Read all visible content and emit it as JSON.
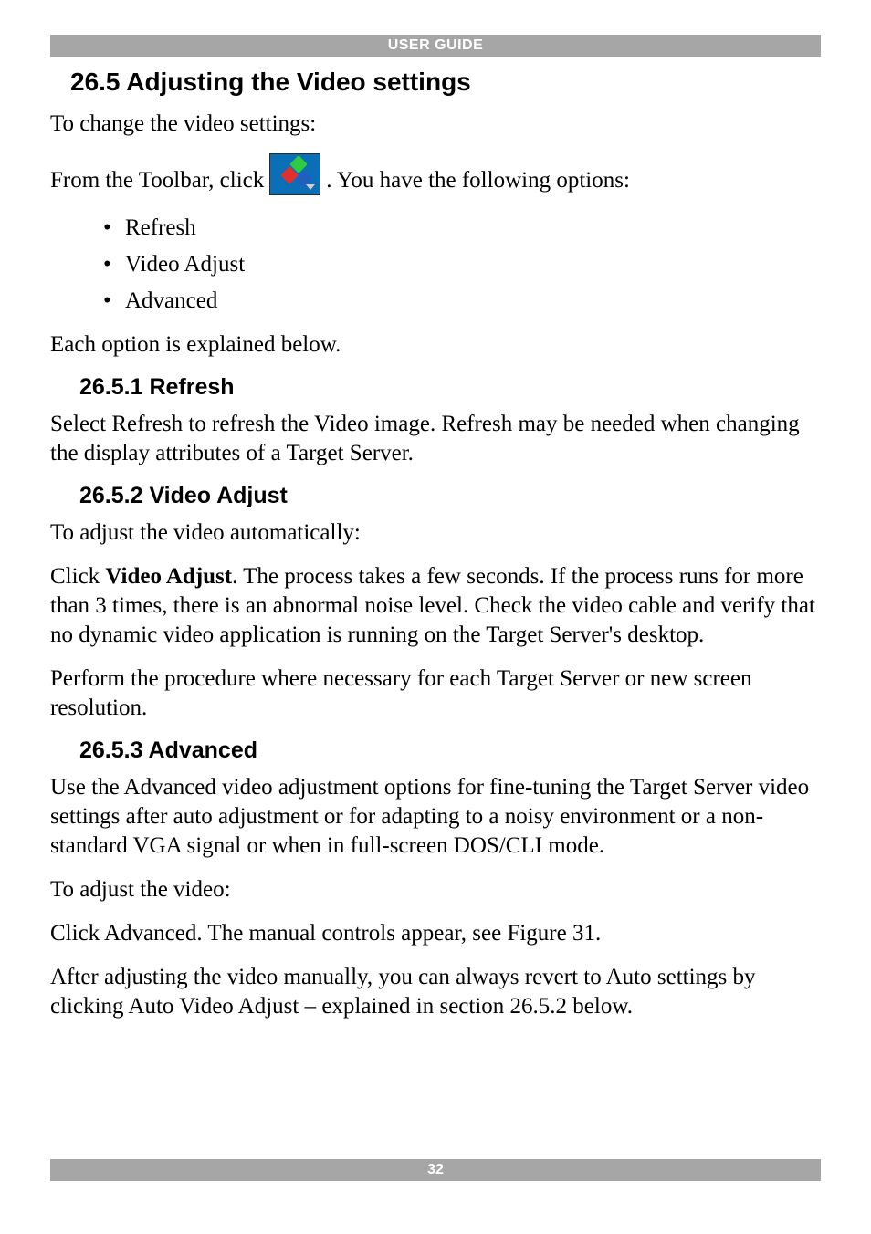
{
  "header": {
    "title": "USER GUIDE"
  },
  "section": {
    "heading": "26.5 Adjusting the Video settings",
    "intro": "To change the video settings:",
    "toolbar_prefix": "From the Toolbar, click ",
    "toolbar_suffix": ". You have the following options:",
    "options": [
      "Refresh",
      "Video Adjust",
      "Advanced"
    ],
    "each_explained": "Each option is explained below."
  },
  "refresh": {
    "heading": "26.5.1 Refresh",
    "body": "Select Refresh to refresh the Video image. Refresh may be needed when changing the display attributes of a Target Server."
  },
  "video_adjust": {
    "heading": "26.5.2 Video Adjust",
    "intro": "To adjust the video automatically:",
    "p1_prefix": "Click ",
    "p1_bold": "Video Adjust",
    "p1_suffix": ". The process takes a few seconds. If the process runs for more than 3 times, there is an abnormal noise level. Check the video cable and verify that no dynamic video application is running on the Target Server's desktop.",
    "p2": "Perform the procedure where necessary for each Target Server or new screen resolution."
  },
  "advanced": {
    "heading": "26.5.3 Advanced",
    "p1": "Use the Advanced video adjustment options for fine-tuning the Target Server video settings after auto adjustment or for adapting to a noisy environment or a non-standard VGA signal or when in full-screen DOS/CLI mode.",
    "p2": "To adjust the video:",
    "p3": "Click Advanced. The manual controls appear, see Figure 31.",
    "p4": "After adjusting the video manually, you can always revert to Auto settings by clicking Auto Video Adjust – explained in section 26.5.2 below."
  },
  "footer": {
    "page_number": "32"
  }
}
